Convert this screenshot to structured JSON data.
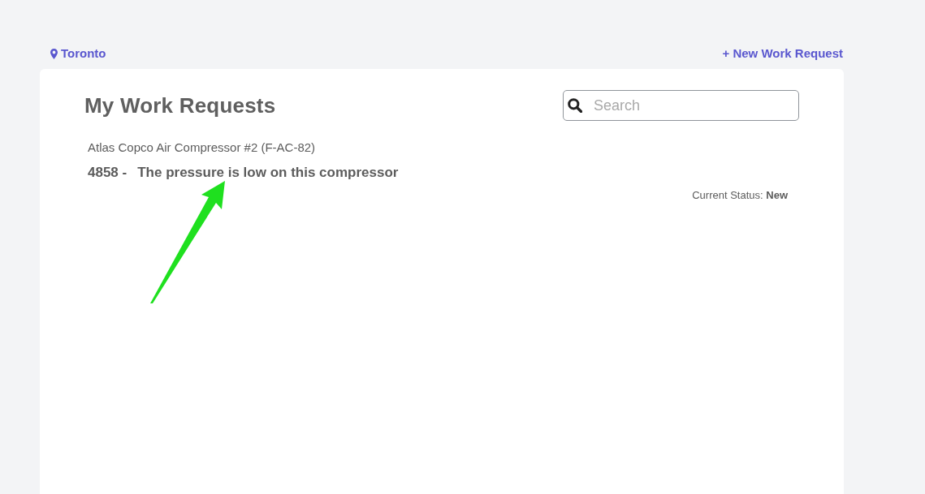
{
  "location_link": {
    "text": "Toronto"
  },
  "new_request_link": {
    "text": "+ New Work Request"
  },
  "panel": {
    "title": "My Work Requests",
    "search": {
      "placeholder": "Search"
    },
    "requests": [
      {
        "asset": "Atlas Copco Air Compressor #2 (F-AC-82)",
        "number": "4858 -",
        "description": "The pressure is low on this compressor",
        "status_line": "Current Status: **New**"
      }
    ]
  },
  "annotations": [
    {
      "kind": "arrow"
    }
  ]
}
